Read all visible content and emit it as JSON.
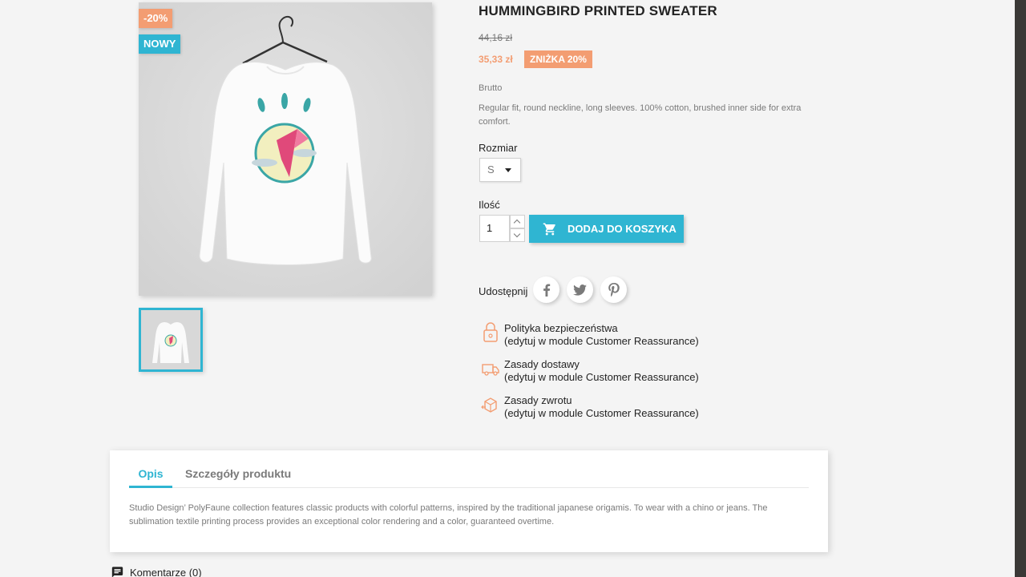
{
  "product": {
    "title": "HUMMINGBIRD PRINTED SWEATER",
    "regular_price": "44,16 zł",
    "current_price": "35,33 zł",
    "discount_badge": "ZNIŻKA 20%",
    "tax_label": "Brutto",
    "short_description": "Regular fit, round neckline, long sleeves. 100% cotton, brushed inner side for extra comfort."
  },
  "flags": {
    "discount": "-20%",
    "new": "NOWY"
  },
  "variants": {
    "size_label": "Rozmiar",
    "size_value": "S",
    "size_options": [
      "S"
    ]
  },
  "cart": {
    "qty_label": "Ilość",
    "qty_value": "1",
    "add_label": "DODAJ DO KOSZYKA",
    "cart_icon": "shopping-cart-icon"
  },
  "share": {
    "label": "Udostępnij",
    "networks": [
      "facebook",
      "twitter",
      "pinterest"
    ]
  },
  "reassurance": [
    {
      "title": "Polityka bezpieczeństwa",
      "subtitle": "(edytuj w module Customer Reassurance)",
      "icon": "padlock-icon"
    },
    {
      "title": "Zasady dostawy",
      "subtitle": "(edytuj w module Customer Reassurance)",
      "icon": "truck-icon"
    },
    {
      "title": "Zasady zwrotu",
      "subtitle": "(edytuj w module Customer Reassurance)",
      "icon": "return-box-icon"
    }
  ],
  "tabs": {
    "items": [
      {
        "label": "Opis",
        "active": true
      },
      {
        "label": "Szczegóły produktu",
        "active": false
      }
    ],
    "description": "Studio Design’ PolyFaune collection features classic products with colorful patterns, inspired by the traditional japanese origamis. To wear with a chino or jeans. The sublimation textile printing process provides an exceptional color rendering and a color, guaranteed overtime."
  },
  "comments": {
    "label": "Komentarze (0)"
  },
  "colors": {
    "accent": "#2fb5d2",
    "discount": "#f39d72",
    "text_dark": "#232323",
    "text_muted": "#7a7a7a",
    "background": "#f4f4f4"
  }
}
